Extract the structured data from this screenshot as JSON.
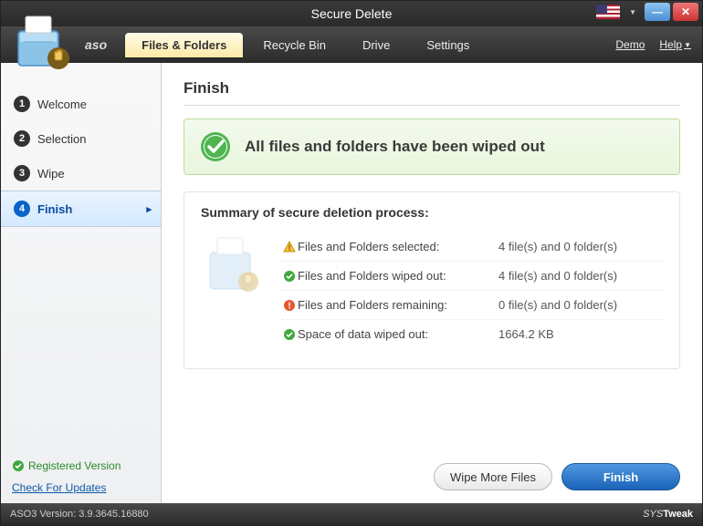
{
  "window": {
    "title": "Secure Delete"
  },
  "titlebar_brand": "aso",
  "menu": {
    "demo": "Demo",
    "help": "Help"
  },
  "tabs": {
    "files_folders": "Files & Folders",
    "recycle_bin": "Recycle Bin",
    "drive": "Drive",
    "settings": "Settings"
  },
  "sidebar": {
    "steps": [
      {
        "num": "1",
        "label": "Welcome"
      },
      {
        "num": "2",
        "label": "Selection"
      },
      {
        "num": "3",
        "label": "Wipe"
      },
      {
        "num": "4",
        "label": "Finish"
      }
    ],
    "registered": "Registered Version",
    "check_updates": "Check For Updates"
  },
  "main": {
    "heading": "Finish",
    "success_msg": "All files and folders have been wiped out",
    "summary_title": "Summary of secure deletion process:",
    "rows": {
      "selected": {
        "label": "Files and Folders selected:",
        "value": "4 file(s) and 0 folder(s)"
      },
      "wiped": {
        "label": "Files and Folders wiped out:",
        "value": "4 file(s) and 0 folder(s)"
      },
      "remaining": {
        "label": "Files and Folders remaining:",
        "value": "0 file(s) and 0 folder(s)"
      },
      "space": {
        "label": "Space of data wiped out:",
        "value": "1664.2 KB"
      }
    },
    "buttons": {
      "wipe_more": "Wipe More Files",
      "finish": "Finish"
    }
  },
  "statusbar": {
    "version": "ASO3 Version: 3.9.3645.16880",
    "brand": "SYSTweak"
  }
}
